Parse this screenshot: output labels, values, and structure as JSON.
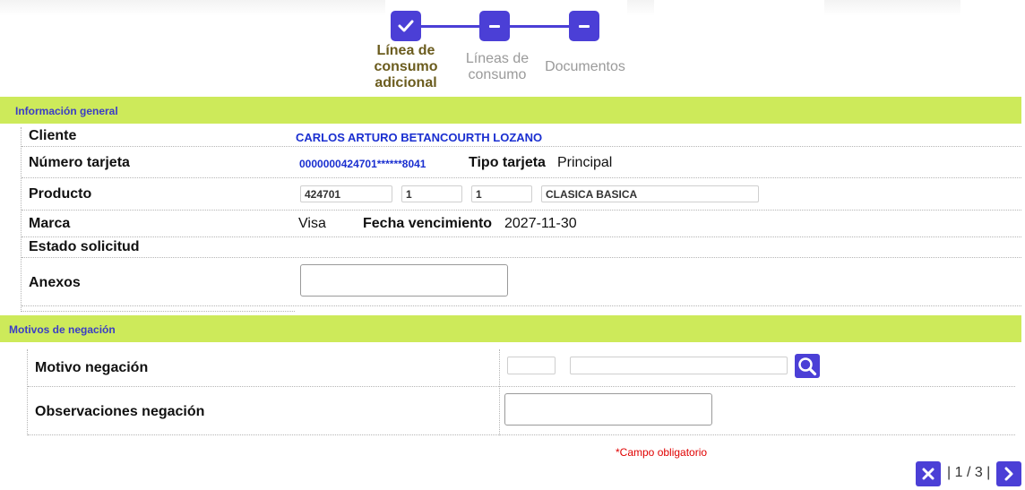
{
  "stepper": {
    "steps": [
      {
        "label_lines": [
          "Línea de",
          "consumo",
          "adicional"
        ],
        "state": "done",
        "icon": "check-icon"
      },
      {
        "label_lines": [
          "Líneas de",
          "consumo"
        ],
        "state": "pending",
        "icon": "minus-icon"
      },
      {
        "label_lines": [
          "Documentos"
        ],
        "state": "pending",
        "icon": "minus-icon"
      }
    ]
  },
  "general": {
    "title": "Información general",
    "cliente_label": "Cliente",
    "cliente_value": "CARLOS ARTURO BETANCOURTH LOZANO",
    "numero_tarjeta_label": "Número tarjeta",
    "numero_tarjeta_value": "0000000424701******8041",
    "tipo_tarjeta_label": "Tipo tarjeta",
    "tipo_tarjeta_value": "Principal",
    "producto_label": "Producto",
    "producto_fields": [
      "424701",
      "1",
      "1",
      "CLASICA BASICA"
    ],
    "marca_label": "Marca",
    "marca_value": "Visa",
    "fecha_vencimiento_label": "Fecha vencimiento",
    "fecha_vencimiento_value": "2027-11-30",
    "estado_label": "Estado solicitud",
    "anexos_label": "Anexos",
    "anexos_value": ""
  },
  "negacion": {
    "title": "Motivos de negación",
    "motivo_label": "Motivo negación",
    "motivo_code": "",
    "motivo_desc": "",
    "observaciones_label": "Observaciones negación",
    "observaciones_value": ""
  },
  "footer": {
    "required_note": "Campo obligatorio",
    "required_marker": "*",
    "pager_text": "| 1 / 3 |"
  },
  "colors": {
    "accent": "#4b3fd6",
    "section_bar": "#cdea5a",
    "link": "#1a2fd0",
    "required": "#e00000"
  }
}
